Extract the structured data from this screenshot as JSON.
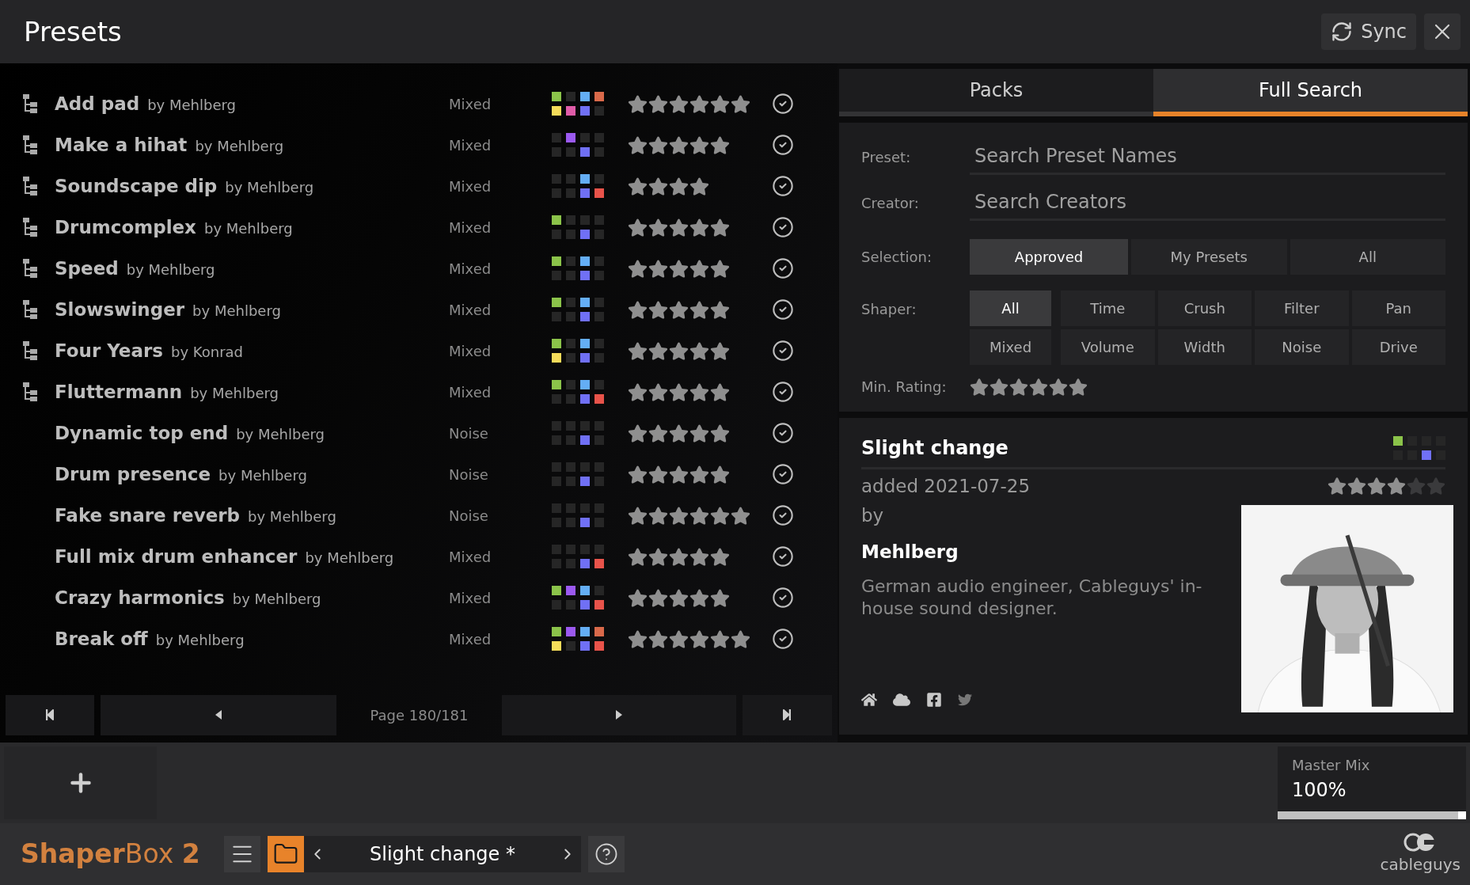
{
  "window": {
    "title": "Presets"
  },
  "toolbar": {
    "sync": "Sync"
  },
  "presets": [
    {
      "name": "Add pad",
      "by": "by Mehlberg",
      "type": "Mixed",
      "multi": true,
      "tiles": [
        {
          "lit": true,
          "color": "#8bc34a"
        },
        {
          "lit": false
        },
        {
          "lit": true,
          "color": "#64aef5"
        },
        {
          "lit": true,
          "color": "#d9694a"
        },
        {
          "lit": true,
          "color": "#f5dc5a"
        },
        {
          "lit": true,
          "color": "#e05ca8"
        },
        {
          "lit": true,
          "color": "#7070f5"
        },
        {
          "lit": false
        }
      ],
      "stars": 6
    },
    {
      "name": "Make a hihat",
      "by": "by Mehlberg",
      "type": "Mixed",
      "multi": true,
      "tiles": [
        {
          "lit": false
        },
        {
          "lit": true,
          "color": "#9b59f0"
        },
        {
          "lit": false
        },
        {
          "lit": false
        },
        {
          "lit": false
        },
        {
          "lit": false
        },
        {
          "lit": true,
          "color": "#7070f5"
        },
        {
          "lit": false
        }
      ],
      "stars": 5
    },
    {
      "name": "Soundscape dip",
      "by": "by Mehlberg",
      "type": "Mixed",
      "multi": true,
      "tiles": [
        {
          "lit": false
        },
        {
          "lit": false
        },
        {
          "lit": true,
          "color": "#64aef5"
        },
        {
          "lit": false
        },
        {
          "lit": false
        },
        {
          "lit": false
        },
        {
          "lit": true,
          "color": "#7070f5"
        },
        {
          "lit": true,
          "color": "#e8534a"
        }
      ],
      "stars": 4
    },
    {
      "name": "Drumcomplex",
      "by": "by Mehlberg",
      "type": "Mixed",
      "multi": true,
      "tiles": [
        {
          "lit": true,
          "color": "#8bc34a"
        },
        {
          "lit": false
        },
        {
          "lit": false
        },
        {
          "lit": false
        },
        {
          "lit": false
        },
        {
          "lit": false
        },
        {
          "lit": true,
          "color": "#7070f5"
        },
        {
          "lit": false
        }
      ],
      "stars": 5
    },
    {
      "name": "Speed",
      "by": "by Mehlberg",
      "type": "Mixed",
      "multi": true,
      "tiles": [
        {
          "lit": true,
          "color": "#8bc34a"
        },
        {
          "lit": false
        },
        {
          "lit": true,
          "color": "#64aef5"
        },
        {
          "lit": false
        },
        {
          "lit": false
        },
        {
          "lit": false
        },
        {
          "lit": true,
          "color": "#7070f5"
        },
        {
          "lit": false
        }
      ],
      "stars": 5
    },
    {
      "name": "Slowswinger",
      "by": "by Mehlberg",
      "type": "Mixed",
      "multi": true,
      "tiles": [
        {
          "lit": true,
          "color": "#8bc34a"
        },
        {
          "lit": false
        },
        {
          "lit": true,
          "color": "#64aef5"
        },
        {
          "lit": false
        },
        {
          "lit": false
        },
        {
          "lit": false
        },
        {
          "lit": true,
          "color": "#7070f5"
        },
        {
          "lit": false
        }
      ],
      "stars": 5
    },
    {
      "name": "Four Years",
      "by": "by Konrad",
      "type": "Mixed",
      "multi": true,
      "tiles": [
        {
          "lit": true,
          "color": "#8bc34a"
        },
        {
          "lit": false
        },
        {
          "lit": true,
          "color": "#64aef5"
        },
        {
          "lit": false
        },
        {
          "lit": true,
          "color": "#f5dc5a"
        },
        {
          "lit": false
        },
        {
          "lit": true,
          "color": "#7070f5"
        },
        {
          "lit": false
        }
      ],
      "stars": 5
    },
    {
      "name": "Fluttermann",
      "by": "by Mehlberg",
      "type": "Mixed",
      "multi": true,
      "tiles": [
        {
          "lit": true,
          "color": "#8bc34a"
        },
        {
          "lit": false
        },
        {
          "lit": true,
          "color": "#64aef5"
        },
        {
          "lit": false
        },
        {
          "lit": false
        },
        {
          "lit": false
        },
        {
          "lit": true,
          "color": "#7070f5"
        },
        {
          "lit": true,
          "color": "#e8534a"
        }
      ],
      "stars": 5
    },
    {
      "name": "Dynamic top end",
      "by": "by Mehlberg",
      "type": "Noise",
      "multi": false,
      "tiles": [
        {
          "lit": false
        },
        {
          "lit": false
        },
        {
          "lit": false
        },
        {
          "lit": false
        },
        {
          "lit": false
        },
        {
          "lit": false
        },
        {
          "lit": true,
          "color": "#7070f5"
        },
        {
          "lit": false
        }
      ],
      "stars": 5
    },
    {
      "name": "Drum presence",
      "by": "by Mehlberg",
      "type": "Noise",
      "multi": false,
      "tiles": [
        {
          "lit": false
        },
        {
          "lit": false
        },
        {
          "lit": false
        },
        {
          "lit": false
        },
        {
          "lit": false
        },
        {
          "lit": false
        },
        {
          "lit": true,
          "color": "#7070f5"
        },
        {
          "lit": false
        }
      ],
      "stars": 5
    },
    {
      "name": "Fake snare reverb",
      "by": "by Mehlberg",
      "type": "Noise",
      "multi": false,
      "tiles": [
        {
          "lit": false
        },
        {
          "lit": false
        },
        {
          "lit": false
        },
        {
          "lit": false
        },
        {
          "lit": false
        },
        {
          "lit": false
        },
        {
          "lit": true,
          "color": "#7070f5"
        },
        {
          "lit": false
        }
      ],
      "stars": 6
    },
    {
      "name": "Full mix drum enhancer",
      "by": "by Mehlberg",
      "type": "Mixed",
      "multi": false,
      "tiles": [
        {
          "lit": false
        },
        {
          "lit": false
        },
        {
          "lit": false
        },
        {
          "lit": false
        },
        {
          "lit": false
        },
        {
          "lit": false
        },
        {
          "lit": true,
          "color": "#7070f5"
        },
        {
          "lit": true,
          "color": "#e8534a"
        }
      ],
      "stars": 5
    },
    {
      "name": "Crazy harmonics",
      "by": "by Mehlberg",
      "type": "Mixed",
      "multi": false,
      "tiles": [
        {
          "lit": true,
          "color": "#8bc34a"
        },
        {
          "lit": true,
          "color": "#9b59f0"
        },
        {
          "lit": true,
          "color": "#64aef5"
        },
        {
          "lit": false
        },
        {
          "lit": false
        },
        {
          "lit": false
        },
        {
          "lit": true,
          "color": "#7070f5"
        },
        {
          "lit": true,
          "color": "#e8534a"
        }
      ],
      "stars": 5
    },
    {
      "name": "Break off",
      "by": "by Mehlberg",
      "type": "Mixed",
      "multi": false,
      "tiles": [
        {
          "lit": true,
          "color": "#8bc34a"
        },
        {
          "lit": true,
          "color": "#9b59f0"
        },
        {
          "lit": true,
          "color": "#64aef5"
        },
        {
          "lit": true,
          "color": "#d9694a"
        },
        {
          "lit": true,
          "color": "#f5dc5a"
        },
        {
          "lit": false
        },
        {
          "lit": true,
          "color": "#7070f5"
        },
        {
          "lit": true,
          "color": "#e8534a"
        }
      ],
      "stars": 6
    }
  ],
  "pagination": {
    "page": "Page 180/181"
  },
  "tabs": [
    {
      "label": "Packs",
      "selected": false
    },
    {
      "label": "Full Search",
      "selected": true
    }
  ],
  "fields": [
    {
      "label": "Preset:",
      "placeholder": "Search Preset Names"
    },
    {
      "label": "Creator:",
      "placeholder": "Search Creators"
    }
  ],
  "selection": {
    "label": "Selection:",
    "options": [
      {
        "label": "Approved",
        "selected": true
      },
      {
        "label": "My Presets",
        "selected": false
      },
      {
        "label": "All",
        "selected": false
      }
    ]
  },
  "shaper": {
    "label": "Shaper:",
    "options": [
      {
        "label": "All",
        "selected": true
      },
      {
        "label": "Time",
        "selected": false
      },
      {
        "label": "Crush",
        "selected": false
      },
      {
        "label": "Filter",
        "selected": false
      },
      {
        "label": "Pan",
        "selected": false
      },
      {
        "label": "Mixed",
        "selected": false
      },
      {
        "label": "Volume",
        "selected": false
      },
      {
        "label": "Width",
        "selected": false
      },
      {
        "label": "Noise",
        "selected": false
      },
      {
        "label": "Drive",
        "selected": false
      }
    ]
  },
  "min_rating": {
    "label": "Min. Rating:",
    "stars": 6
  },
  "detail": {
    "title": "Slight change",
    "tiles": [
      {
        "lit": true,
        "color": "#8bc34a"
      },
      {
        "lit": false
      },
      {
        "lit": false
      },
      {
        "lit": false
      },
      {
        "lit": false
      },
      {
        "lit": false
      },
      {
        "lit": true,
        "color": "#7070f5"
      },
      {
        "lit": false
      }
    ],
    "added": "added 2021-07-25",
    "stars": 4,
    "by": "by",
    "creator": "Mehlberg",
    "bio": "German audio engineer, Cableguys' in-house sound designer."
  },
  "master_mix": {
    "label": "Master Mix",
    "value": "100%",
    "level": 1.0
  },
  "footer": {
    "logo": "**Shaper**Box **2**",
    "preset": "Slight change *",
    "brand": "cableguys"
  }
}
